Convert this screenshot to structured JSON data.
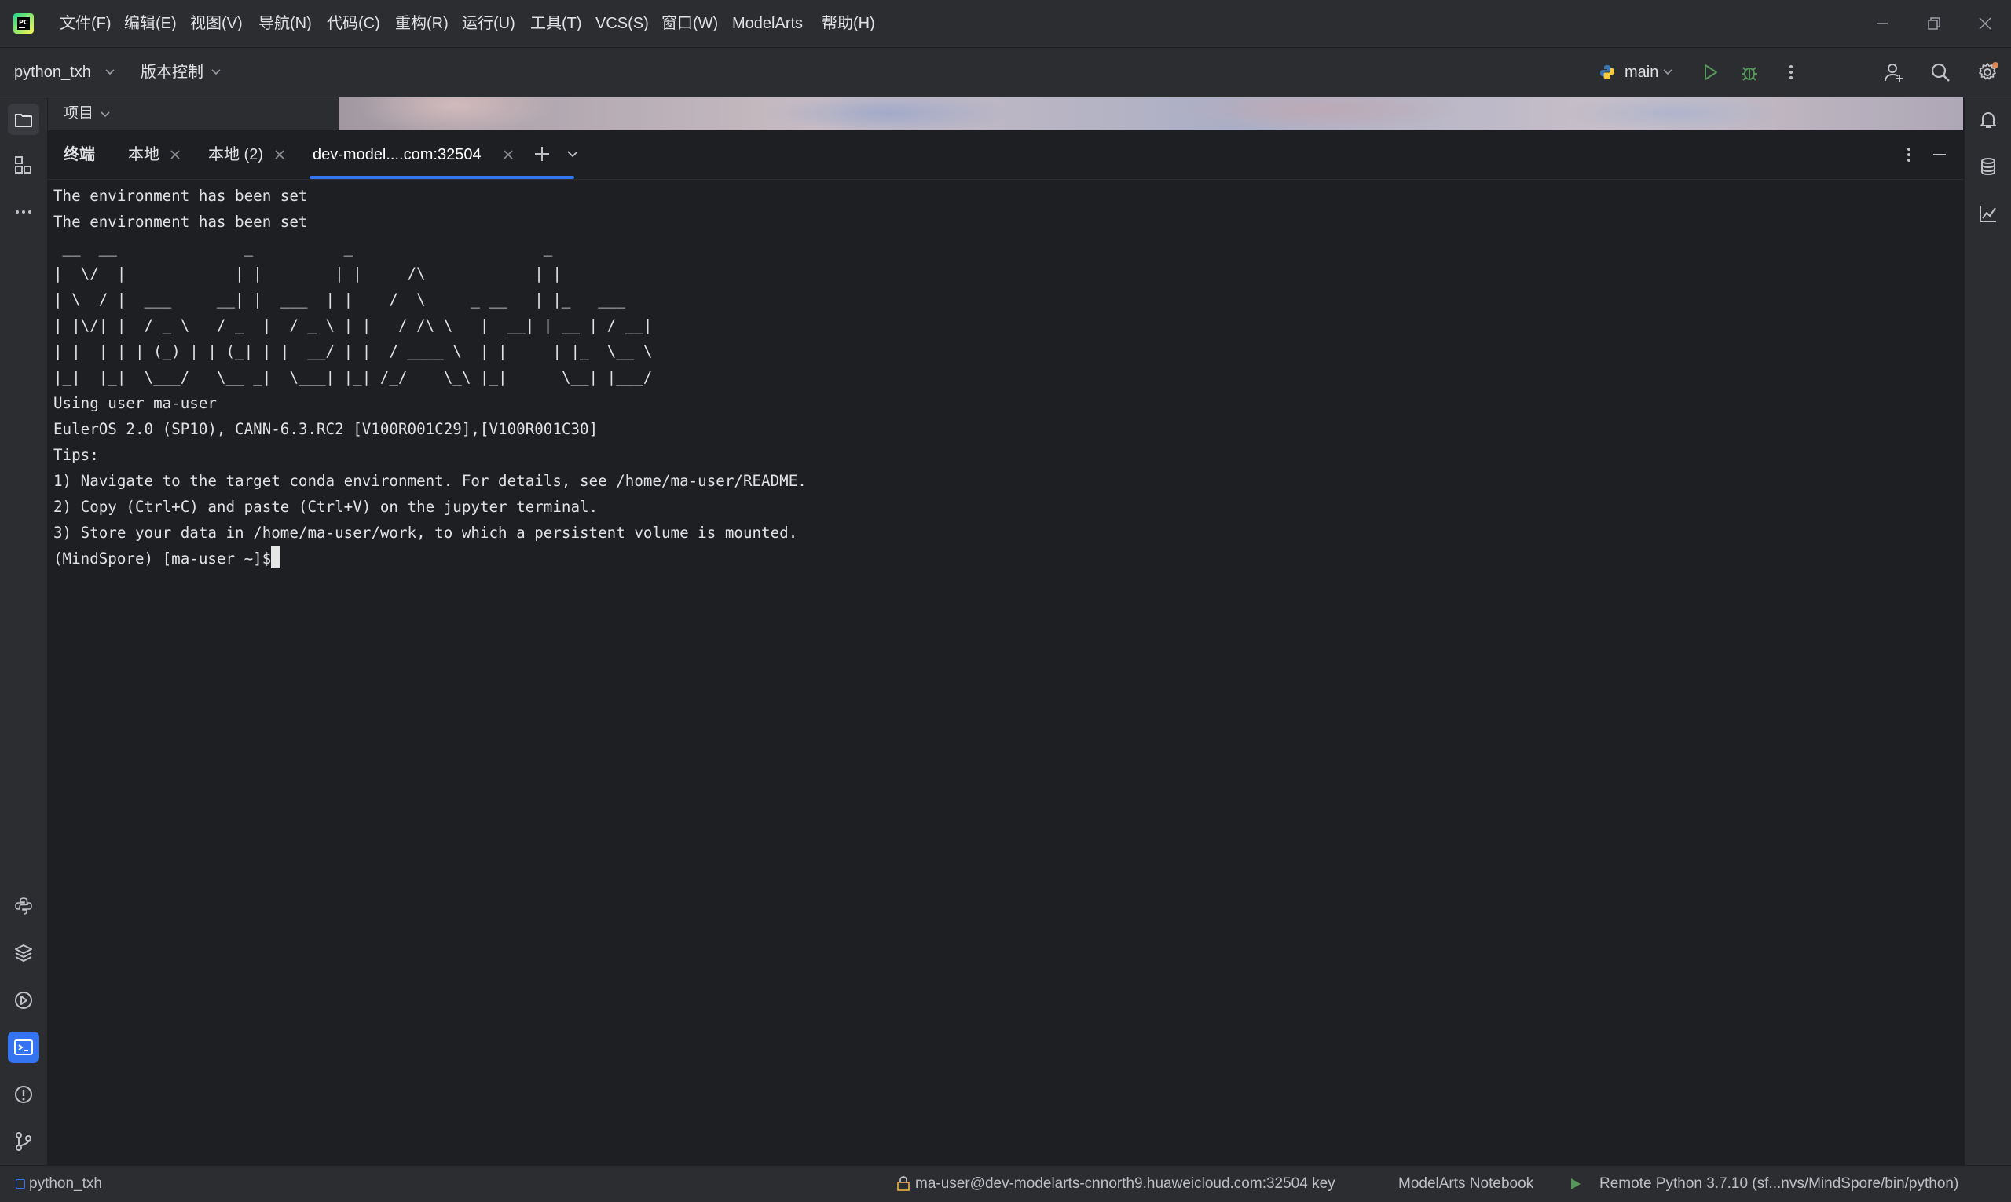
{
  "app": {
    "menu": [
      "文件(F)",
      "编辑(E)",
      "视图(V)",
      "导航(N)",
      "代码(C)",
      "重构(R)",
      "运行(U)",
      "工具(T)",
      "VCS(S)",
      "窗口(W)",
      "ModelArts",
      "帮助(H)"
    ]
  },
  "toolbar": {
    "project": "python_txh",
    "vcs": "版本控制",
    "branch": "main"
  },
  "panel": {
    "project_label": "项目",
    "terminal_title": "终端",
    "tabs": [
      "本地",
      "本地 (2)",
      "dev-model....com:32504"
    ]
  },
  "terminal": {
    "lines": [
      "The environment has been set",
      "The environment has been set",
      " __  __              _          _                     _",
      "|  \\/  |            | |        | |     /\\            | |",
      "| \\  / |  ___     __| |  ___  | |    /  \\     _ __   | |_   ___",
      "| |\\/| |  / _ \\   / _  |  / _ \\ | |   / /\\ \\   |  __| | __ | / __|",
      "| |  | | | (_) | | (_| | |  __/ | |  / ____ \\  | |     | |_  \\__ \\",
      "|_|  |_|  \\___/   \\__ _|  \\___| |_| /_/    \\_\\ |_|      \\__| |___/",
      "Using user ma-user",
      "EulerOS 2.0 (SP10), CANN-6.3.RC2 [V100R001C29],[V100R001C30]",
      "Tips:",
      "1) Navigate to the target conda environment. For details, see /home/ma-user/README.",
      "2) Copy (Ctrl+C) and paste (Ctrl+V) on the jupyter terminal.",
      "3) Store your data in /home/ma-user/work, to which a persistent volume is mounted."
    ],
    "prompt": "(MindSpore) [ma-user ~]$"
  },
  "status": {
    "project": "python_txh",
    "connection": "ma-user@dev-modelarts-cnnorth9.huaweicloud.com:32504 key",
    "notebook": "ModelArts Notebook",
    "interpreter": "Remote Python 3.7.10 (sf...nvs/MindSpore/bin/python)"
  },
  "colors": {
    "accent": "#3574f0",
    "run_green": "#57965c"
  },
  "icons": [
    "app-logo-icon",
    "minimize-icon",
    "restore-icon",
    "close-icon",
    "run-icon",
    "debug-icon",
    "more-icon",
    "add-user-icon",
    "search-icon",
    "settings-icon",
    "folder-icon",
    "structure-icon",
    "python-icon",
    "layers-icon",
    "services-icon",
    "terminal-icon",
    "problems-icon",
    "git-icon",
    "bell-icon",
    "database-icon",
    "profiler-icon"
  ]
}
